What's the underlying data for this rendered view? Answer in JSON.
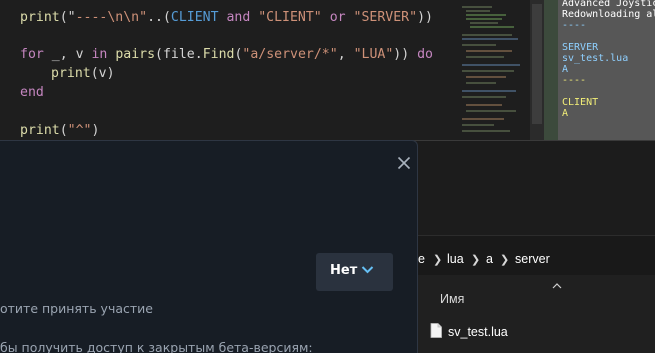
{
  "editor": {
    "line1": {
      "fn": "print",
      "open": "(\"",
      "str1": "----\\n\\n\"",
      "op": "..(",
      "cst": "CLIENT",
      "and": " and ",
      "str2": "\"CLIENT\"",
      "or": " or ",
      "str3": "\"SERVER\"",
      "close": "))"
    },
    "line2": {
      "kw_for": "for",
      "sep": " _, ",
      "var_v": "v",
      "kw_in": " in ",
      "fn_pairs": "pairs",
      "p1": "(",
      "var_file": "file",
      "dot": ".",
      "fn_find": "Find",
      "p2": "(",
      "str1": "\"a/server/*\"",
      "comma": ", ",
      "str2": "\"LUA\"",
      "p3": "))",
      "kw_do": " do"
    },
    "line3": {
      "fn": "print",
      "open": "(",
      "var": "v",
      "close": ")"
    },
    "line4": {
      "kw": "end"
    },
    "line5": {
      "fn": "print",
      "open": "(",
      "str": "\"^\"",
      "close": ")"
    }
  },
  "console": {
    "lines": [
      {
        "text": "Advanced Joystic",
        "color": "white"
      },
      {
        "text": "Redownloading al",
        "color": "white"
      },
      {
        "text": "----",
        "color": "blue"
      },
      {
        "text": "",
        "color": "white"
      },
      {
        "text": "SERVER",
        "color": "blue"
      },
      {
        "text": "sv_test.lua",
        "color": "blue"
      },
      {
        "text": "A",
        "color": "blue"
      },
      {
        "text": "----",
        "color": "yellow"
      },
      {
        "text": "",
        "color": "white"
      },
      {
        "text": "CLIENT",
        "color": "yellow"
      },
      {
        "text": "A",
        "color": "yellow"
      }
    ]
  },
  "explorer": {
    "breadcrumb": [
      "e",
      "lua",
      "a",
      "server"
    ],
    "column_name": "Имя",
    "files": [
      {
        "name": "sv_test.lua",
        "icon": "lua-file-icon"
      }
    ]
  },
  "dialog": {
    "beta_select": {
      "value": "Нет",
      "icon": "chevron-down-icon"
    },
    "close_icon": "close-icon",
    "text_participate": "отите принять участие",
    "text_access": "бы получить доступ к закрытым бета-версиям:"
  },
  "colors": {
    "dialog_bg": "#171d25",
    "select_bg": "#2a323e",
    "accent_blue": "#66c0f4",
    "console_bg": "#575757"
  }
}
